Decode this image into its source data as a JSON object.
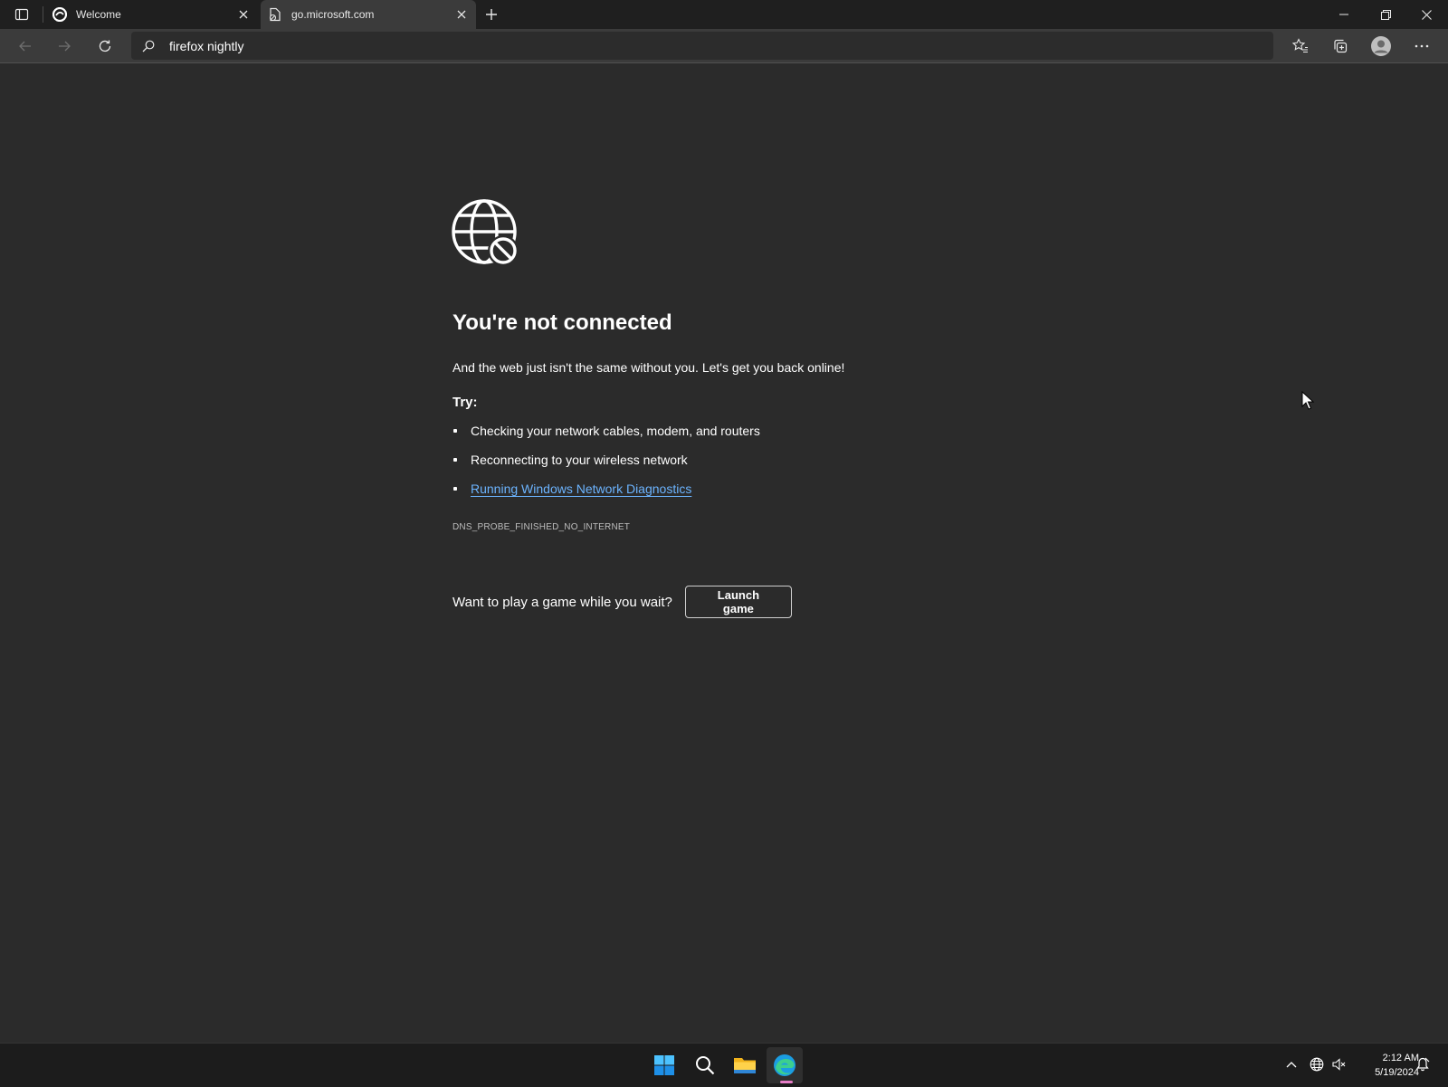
{
  "browser": {
    "tabs": [
      {
        "title": "Welcome",
        "favicon": "edge-welcome-icon",
        "active": false
      },
      {
        "title": "go.microsoft.com",
        "favicon": "page-error-icon",
        "active": true
      }
    ],
    "address": {
      "value": "firefox nightly",
      "icon": "search-icon"
    },
    "window_controls": [
      "minimize-icon",
      "restore-icon",
      "close-icon"
    ],
    "toolbar_icons": [
      "back-arrow-icon",
      "forward-arrow-icon",
      "refresh-icon",
      "favorites-icon",
      "collections-icon",
      "profile-icon",
      "more-icon"
    ]
  },
  "page": {
    "icon": "globe-blocked-icon",
    "heading": "You're not connected",
    "subtext": "And the web just isn't the same without you. Let's get you back online!",
    "try_label": "Try:",
    "suggestions": [
      "Checking your network cables, modem, and routers",
      "Reconnecting to your wireless network",
      "Running Windows Network Diagnostics"
    ],
    "error_code": "DNS_PROBE_FINISHED_NO_INTERNET",
    "game_prompt": "Want to play a game while you wait?",
    "launch_button": "Launch game"
  },
  "taskbar": {
    "apps": [
      "windows-start-icon",
      "search-icon",
      "file-explorer-icon",
      "edge-icon"
    ],
    "tray": [
      "chevron-up-icon",
      "network-globe-icon",
      "volume-muted-icon",
      "notification-icon"
    ],
    "time": "2:12 AM",
    "date": "5/19/2024"
  },
  "colors": {
    "page_bg": "#2b2b2b",
    "tabstrip_bg": "#1f1f1f",
    "toolbar_bg": "#3b3b3b",
    "link": "#6cb4ff",
    "taskbar_bg": "#1c1c1c"
  }
}
